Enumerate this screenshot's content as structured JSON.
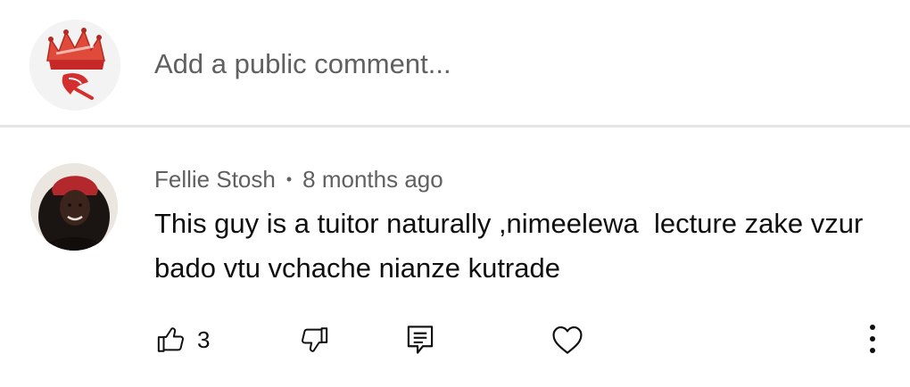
{
  "add_comment": {
    "placeholder": "Add a public comment..."
  },
  "comment": {
    "author": "Fellie Stosh",
    "separator": "•",
    "time": "8 months ago",
    "text": "This guy is a tuitor naturally ,nimeelewa  lecture zake vzur bado vtu vchache nianze kutrade",
    "likes": "3"
  },
  "icons": {
    "like": "thumb-up-icon",
    "dislike": "thumb-down-icon",
    "reply": "reply-comment-icon",
    "heart": "heart-icon",
    "more": "more-vertical-icon"
  },
  "colors": {
    "text_primary": "#0f0f0f",
    "text_secondary": "#606060",
    "divider": "#e5e5e5",
    "avatar_accent": "#d32f2f"
  }
}
